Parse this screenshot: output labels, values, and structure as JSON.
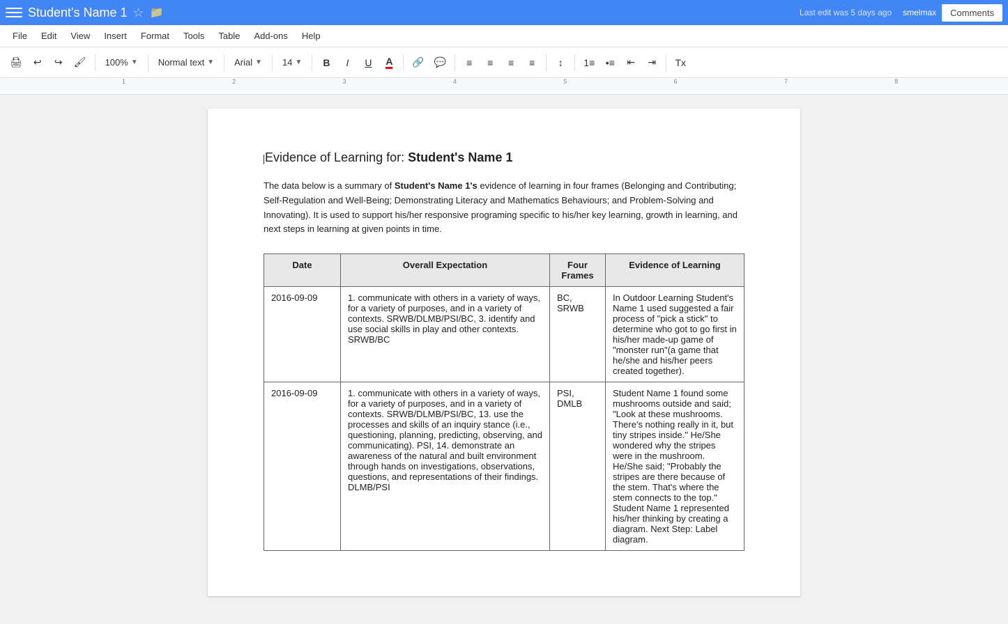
{
  "topbar": {
    "doc_title": "Student's Name 1",
    "last_edit": "Last edit was 5 days ago",
    "user": "smelmax",
    "comments_label": "Comments"
  },
  "menu": {
    "items": [
      "File",
      "Edit",
      "View",
      "Insert",
      "Format",
      "Tools",
      "Table",
      "Add-ons",
      "Help"
    ]
  },
  "toolbar": {
    "zoom": "100%",
    "style": "Normal text",
    "font": "Arial",
    "size": "14",
    "bold": "B",
    "italic": "I",
    "underline": "U",
    "align_left": "align-left",
    "align_center": "align-center",
    "align_right": "align-right",
    "align_justify": "align-justify"
  },
  "document": {
    "heading": "Evidence of Learning for: ",
    "heading_name": "Student's Name 1",
    "intro_start": "The data below is a summary of ",
    "intro_bold": "Student's Name 1's",
    "intro_end": " evidence of learning in four frames (Belonging and Contributing; Self-Regulation and Well-Being; Demonstrating Literacy and Mathematics Behaviours; and Problem-Solving and Innovating). It is used to support his/her responsive programing specific to his/her key learning, growth in learning, and next steps in learning at given points in time.",
    "table": {
      "headers": [
        "Date",
        "Overall Expectation",
        "Four Frames",
        "Evidence of Learning"
      ],
      "rows": [
        {
          "date": "2016-09-09",
          "expectation": "1. communicate with others in a variety of ways, for a variety of purposes, and in a variety of contexts. SRWB/DLMB/PSI/BC, 3. identify and use social skills in play and other contexts. SRWB/BC",
          "frames": "BC, SRWB",
          "evidence": "In Outdoor Learning Student's Name 1 used suggested a fair process of \"pick a stick\" to determine who got to go first in his/her made-up game of \"monster run\"(a game that he/she and his/her peers created together)."
        },
        {
          "date": "2016-09-09",
          "expectation": "1. communicate with others in a variety of ways, for a variety of purposes, and in a variety of contexts. SRWB/DLMB/PSI/BC, 13. use the processes and skills of an inquiry stance (i.e., questioning, planning, predicting, observing, and communicating). PSI, 14. demonstrate an awareness of the natural and built environment through hands on investigations, observations, questions, and representations of their findings. DLMB/PSI",
          "frames": "PSI, DMLB",
          "evidence": "Student Name 1 found some mushrooms outside and said; \"Look at these mushrooms. There's nothing really in it, but tiny stripes inside.\" He/She wondered why the stripes were in the mushroom. He/She said; \"Probably the stripes are there because of the stem. That's where the stem connects to the top.\" Student Name 1 represented his/her thinking by creating a diagram. Next Step: Label diagram."
        }
      ]
    }
  }
}
